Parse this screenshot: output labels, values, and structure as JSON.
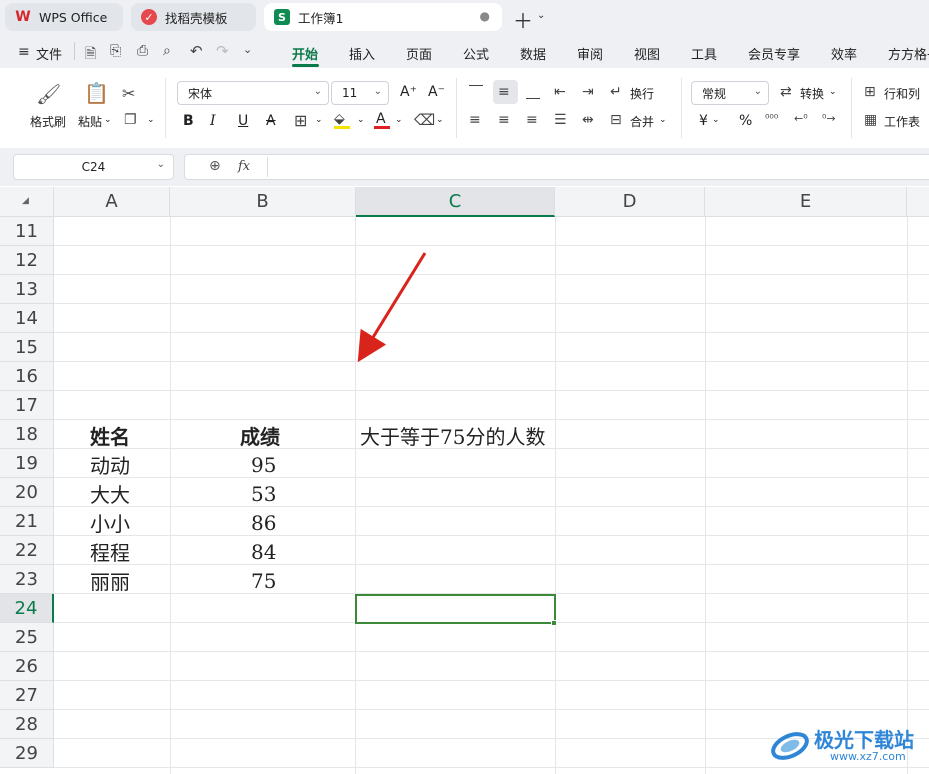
{
  "tabs": [
    {
      "label": "WPS Office",
      "icon": "wps-logo-icon"
    },
    {
      "label": "找稻壳模板",
      "icon": "docer-icon"
    },
    {
      "label": "工作簿1",
      "icon": "spreadsheet-icon",
      "icon_letter": "S"
    }
  ],
  "menu": [
    "文件",
    "开始",
    "插入",
    "页面",
    "公式",
    "数据",
    "审阅",
    "视图",
    "工具",
    "会员专享",
    "效率",
    "方方格子"
  ],
  "ribbon": {
    "format_painter": "格式刷",
    "paste": "粘贴",
    "font_name": "宋体",
    "font_size": "11",
    "wrap": "换行",
    "merge": "合并",
    "number_format": "常规",
    "convert": "转换",
    "rows_cols": "行和列",
    "worksheet": "工作表",
    "bold": "B",
    "italic": "I",
    "underline": "U",
    "strike": "A",
    "font_color": "A",
    "yen": "¥",
    "percent": "%"
  },
  "formula_bar": {
    "cell_ref": "C24",
    "fx": "fx",
    "value": ""
  },
  "columns": [
    "A",
    "B",
    "C",
    "D",
    "E"
  ],
  "rows": [
    "11",
    "12",
    "13",
    "14",
    "15",
    "16",
    "17",
    "18",
    "19",
    "20",
    "21",
    "22",
    "23",
    "24",
    "25",
    "26",
    "27",
    "28",
    "29"
  ],
  "selected_row": "24",
  "selected_col": "C",
  "sheet": {
    "header_name": "姓名",
    "header_score": "成绩",
    "question": "大于等于75分的人数",
    "records": [
      {
        "name": "动动",
        "score": "95"
      },
      {
        "name": "大大",
        "score": "53"
      },
      {
        "name": "小小",
        "score": "86"
      },
      {
        "name": "程程",
        "score": "84"
      },
      {
        "name": "丽丽",
        "score": "75"
      }
    ]
  },
  "watermark": {
    "text": "极光下载站",
    "url": "www.xz7.com"
  },
  "colors": {
    "accent": "#0b7a4b",
    "arrow": "#d9241c",
    "selection": "#3a8a3a"
  }
}
